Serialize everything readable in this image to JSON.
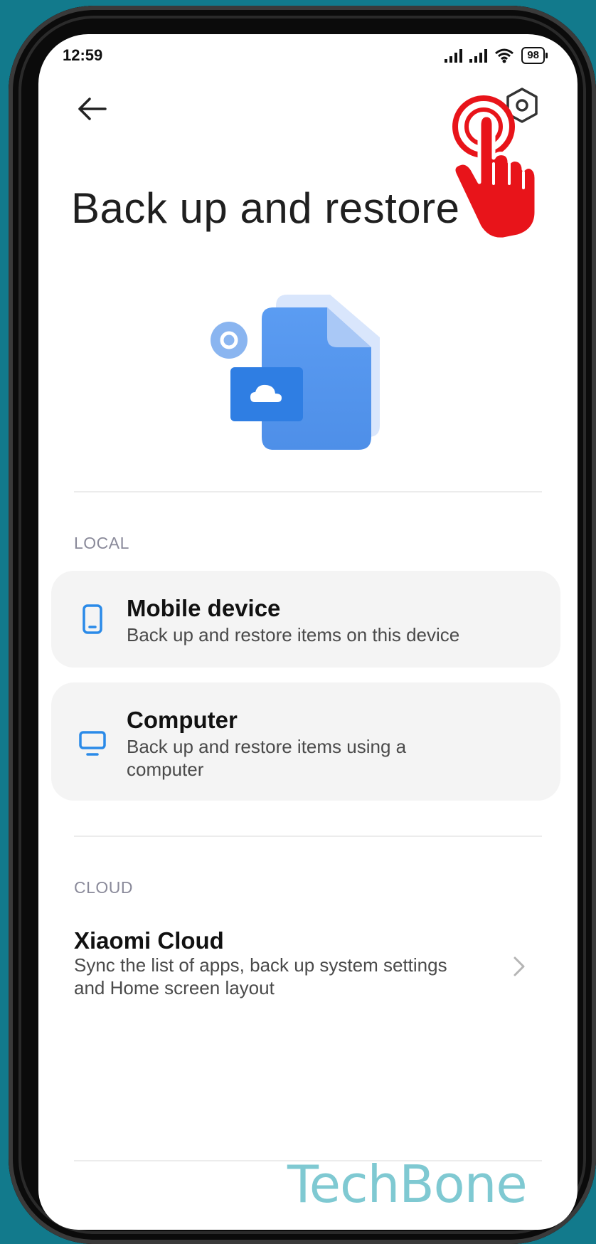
{
  "status_bar": {
    "time": "12:59",
    "battery": "98"
  },
  "header": {
    "title": "Back up and restore"
  },
  "local": {
    "label": "LOCAL",
    "items": [
      {
        "title": "Mobile device",
        "subtitle": "Back up and restore items on this device",
        "icon": "phone-icon"
      },
      {
        "title": "Computer",
        "subtitle": "Back up and restore items using a computer",
        "icon": "monitor-icon"
      }
    ]
  },
  "cloud": {
    "label": "CLOUD",
    "item": {
      "title": "Xiaomi Cloud",
      "subtitle": "Sync the list of apps, back up system settings and Home screen layout",
      "icon": "chevron-right-icon"
    }
  },
  "watermark": "TechBone",
  "colors": {
    "accent": "#2a8ae8",
    "background": "#127a8c",
    "tap_indicator": "#e8141a"
  }
}
